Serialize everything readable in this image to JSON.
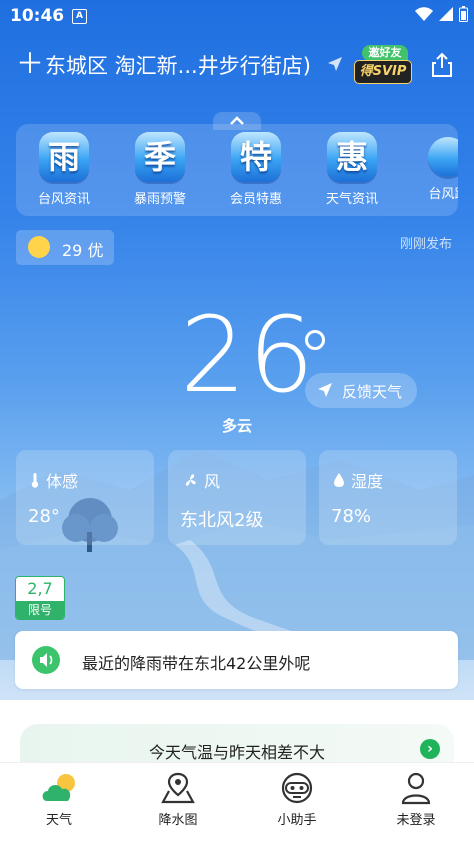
{
  "status_bar": {
    "time": "10:46",
    "input_method": "A"
  },
  "header": {
    "location": "东城区 淘汇新...井步行街店)",
    "vip_top": "邀好友",
    "vip_bottom": "得SVIP"
  },
  "services": [
    {
      "icon_char": "雨",
      "label": "台风资讯"
    },
    {
      "icon_char": "季",
      "label": "暴雨预警"
    },
    {
      "icon_char": "特",
      "label": "会员特惠"
    },
    {
      "icon_char": "惠",
      "label": "天气资讯"
    },
    {
      "icon_char": "",
      "label": "台风路"
    }
  ],
  "aqi": {
    "value": "29 优"
  },
  "publish_time": "刚刚发布",
  "weather": {
    "temperature": "26",
    "condition": "多云",
    "feedback_label": "反馈天气"
  },
  "details": [
    {
      "title": "体感",
      "value": "28°",
      "icon": "thermometer-icon"
    },
    {
      "title": "风",
      "value": "东北风2级",
      "icon": "fan-icon"
    },
    {
      "title": "湿度",
      "value": "78%",
      "icon": "droplet-icon"
    }
  ],
  "traffic_limit": {
    "numbers": "2,7",
    "label": "限号"
  },
  "rain_notice": {
    "text": "最近的降雨带在东北42公里外呢"
  },
  "tip": {
    "text": "今天气温与昨天相差不大",
    "arrow": "›"
  },
  "tabs": [
    {
      "label": "天气",
      "icon": "weather-icon",
      "active": true
    },
    {
      "label": "降水图",
      "icon": "map-pin-icon",
      "active": false
    },
    {
      "label": "小助手",
      "icon": "assistant-icon",
      "active": false
    },
    {
      "label": "未登录",
      "icon": "user-icon",
      "active": false
    }
  ],
  "colors": {
    "primary_blue": "#2b7be6",
    "accent_green": "#2fb36a"
  }
}
